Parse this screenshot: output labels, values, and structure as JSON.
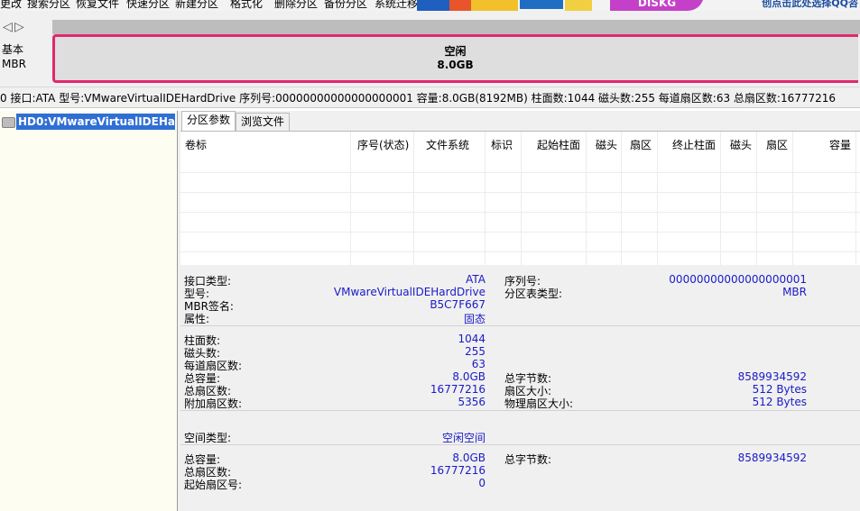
{
  "menu": {
    "items": [
      "更改",
      "搜索分区",
      "恢复文件",
      "快速分区",
      "新建分区",
      "格式化",
      "删除分区",
      "备份分区",
      "系统迁移"
    ],
    "banner_text": "DISKG",
    "link_text": "创点击此处选择QQ咨"
  },
  "nav": {
    "back_icon": "chevron-left-icon",
    "forward_icon": "chevron-right-icon"
  },
  "disk_map": {
    "kind": "基本",
    "scheme": "MBR",
    "free_label": "空闲",
    "free_size": "8.0GB",
    "accent_color": "#e0286e"
  },
  "info_line": "0 接口:ATA  型号:VMwareVirtualIDEHardDrive  序列号:00000000000000000001  容量:8.0GB(8192MB)  柱面数:1044  磁头数:255  每道扇区数:63  总扇区数:16777216",
  "tree": {
    "disk_item": "HD0:VMwareVirtualIDEHardDrive"
  },
  "tabs": {
    "partition": "分区参数",
    "browse": "浏览文件"
  },
  "table": {
    "columns": [
      "卷标",
      "序号(状态)",
      "文件系统",
      "标识",
      "起始柱面",
      "磁头",
      "扇区",
      "终止柱面",
      "磁头",
      "扇区",
      "容量"
    ]
  },
  "details": {
    "disk": {
      "interface_label": "接口类型:",
      "interface_value": "ATA",
      "model_label": "型号:",
      "model_value": "VMwareVirtualIDEHardDrive",
      "mbr_sig_label": "MBR签名:",
      "mbr_sig_value": "B5C7F667",
      "attr_label": "属性:",
      "attr_value": "固态",
      "serial_label": "序列号:",
      "serial_value": "00000000000000000001",
      "ptable_label": "分区表类型:",
      "ptable_value": "MBR"
    },
    "geometry": {
      "cyl_label": "柱面数:",
      "cyl_value": "1044",
      "heads_label": "磁头数:",
      "heads_value": "255",
      "spt_label": "每道扇区数:",
      "spt_value": "63",
      "cap_label": "总容量:",
      "cap_value": "8.0GB",
      "sectors_label": "总扇区数:",
      "sectors_value": "16777216",
      "extra_label": "附加扇区数:",
      "extra_value": "5356",
      "bytes_label": "总字节数:",
      "bytes_value": "8589934592",
      "secsize_label": "扇区大小:",
      "secsize_value": "512 Bytes",
      "physsec_label": "物理扇区大小:",
      "physsec_value": "512 Bytes"
    },
    "space": {
      "type_label": "空间类型:",
      "type_value": "空闲空间"
    },
    "free": {
      "cap_label": "总容量:",
      "cap_value": "8.0GB",
      "sectors_label": "总扇区数:",
      "sectors_value": "16777216",
      "start_label": "起始扇区号:",
      "start_value": "0",
      "bytes_label": "总字节数:",
      "bytes_value": "8589934592"
    }
  }
}
